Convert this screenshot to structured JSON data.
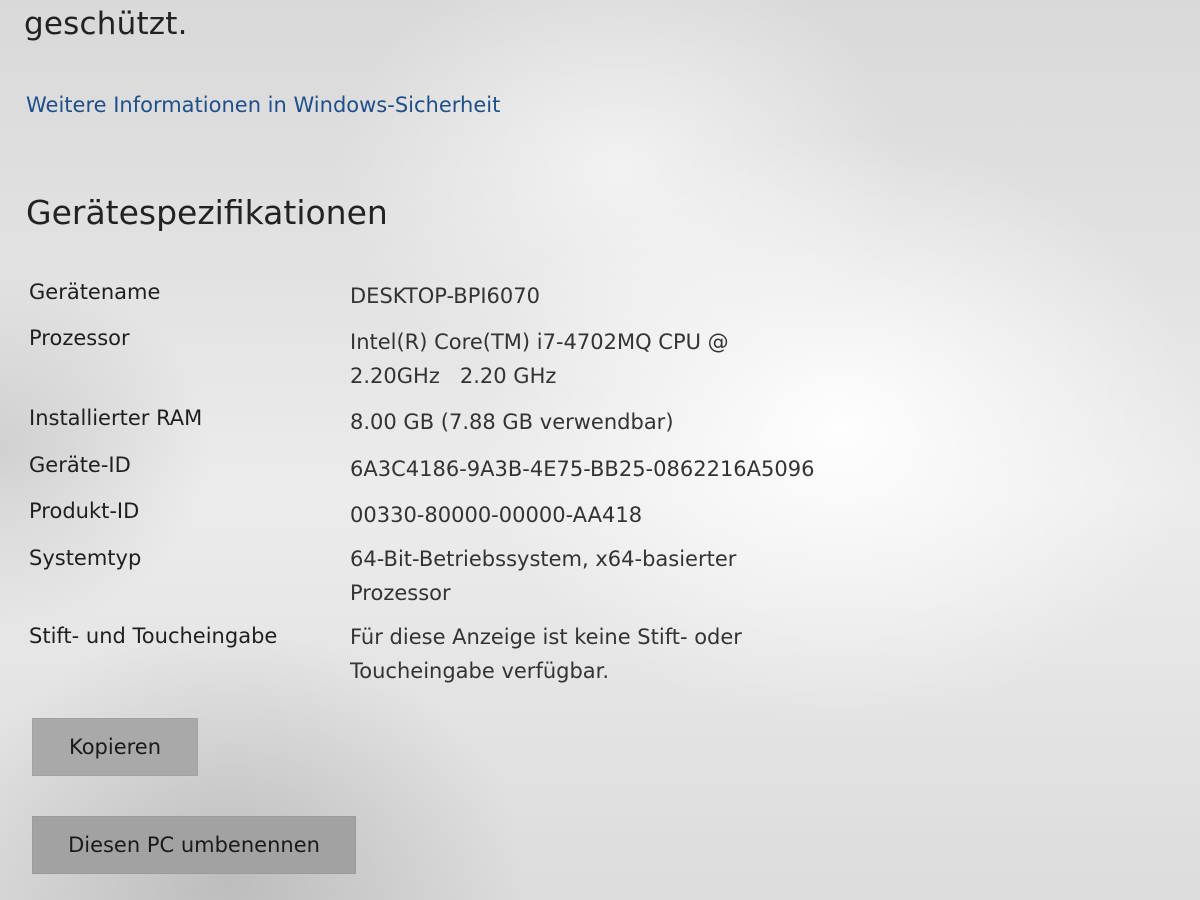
{
  "security": {
    "protected_text": "geschützt.",
    "more_info_link": "Weitere Informationen in Windows-Sicherheit"
  },
  "device_specs": {
    "title": "Gerätespezifikationen",
    "rows": [
      {
        "label": "Gerätename",
        "value": "DESKTOP-BPI6070"
      },
      {
        "label": "Prozessor",
        "value": "Intel(R) Core(TM) i7-4702MQ CPU @ 2.20GHz   2.20 GHz"
      },
      {
        "label": "Installierter RAM",
        "value": "8.00 GB (7.88 GB verwendbar)"
      },
      {
        "label": "Geräte-ID",
        "value": "6A3C4186-9A3B-4E75-BB25-0862216A5096"
      },
      {
        "label": "Produkt-ID",
        "value": "00330-80000-00000-AA418"
      },
      {
        "label": "Systemtyp",
        "value": "64-Bit-Betriebssystem, x64-basierter Prozessor"
      },
      {
        "label": "Stift- und Toucheingabe",
        "value": "Für diese Anzeige ist keine Stift- oder Toucheingabe verfügbar."
      }
    ],
    "copy_button": "Kopieren"
  },
  "rename_button": "Diesen PC umbenennen"
}
